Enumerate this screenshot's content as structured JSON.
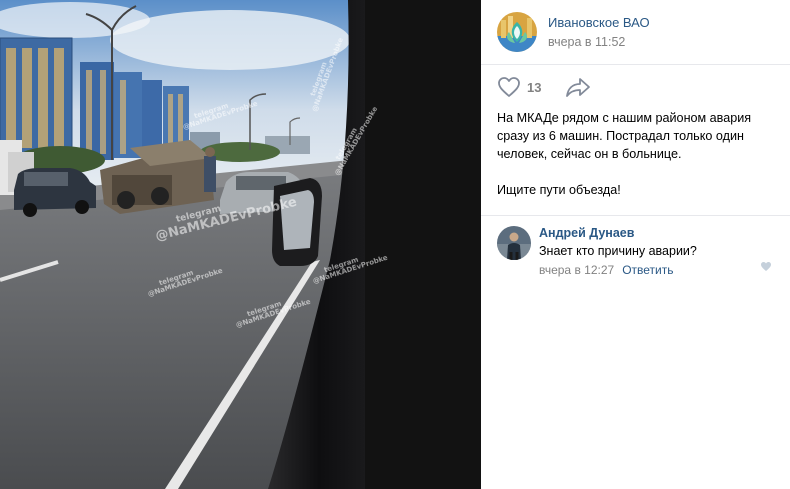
{
  "photo": {
    "watermark_top": "telegram",
    "watermark_handle": "@NaMKADEvProbke"
  },
  "post": {
    "group_name": "Ивановское ВАО",
    "date": "вчера в 11:52",
    "like_count": "13",
    "text": "На МКАДе рядом с нашим районом авария сразу из 6 машин. Пострадал только один человек, сейчас он в больнице.\n\nИщите пути объезда!"
  },
  "comment": {
    "author": "Андрей Дунаев",
    "text": "Знает кто причину аварии?",
    "date": "вчера в 12:27",
    "reply_label": "Ответить"
  },
  "icons": {
    "like": "heart-icon",
    "share": "share-arrow-icon",
    "comment_like": "heart-icon"
  },
  "colors": {
    "link": "#2a5885",
    "meta": "#828282",
    "divider": "#e7e8ec"
  }
}
